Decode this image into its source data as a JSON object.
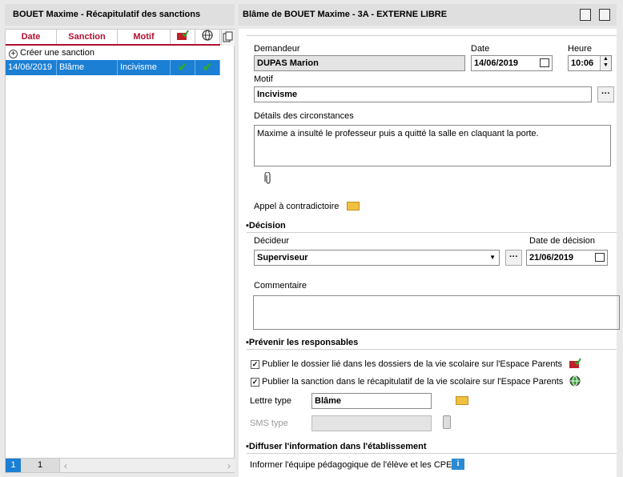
{
  "left": {
    "title": "BOUET Maxime - Récapitulatif des sanctions",
    "columns": [
      "Date",
      "Sanction",
      "Motif"
    ],
    "create_label": "Créer une sanction",
    "row": {
      "date": "14/06/2019",
      "sanction": "Blâme",
      "motif": "Incivisme"
    },
    "pager": {
      "first": "1",
      "current": "1"
    }
  },
  "right": {
    "title": "Blâme de BOUET Maxime  - 3A - EXTERNE LIBRE",
    "demandeur_label": "Demandeur",
    "demandeur_value": "DUPAS Marion",
    "date_label": "Date",
    "date_value": "14/06/2019",
    "heure_label": "Heure",
    "heure_value": "10:06",
    "motif_label": "Motif",
    "motif_value": "Incivisme",
    "details_label": "Détails des circonstances",
    "details_value": "Maxime a insulté le professeur puis a quitté la salle en claquant la porte.",
    "appel_label": "Appel à contradictoire",
    "decision_section": "Décision",
    "decideur_label": "Décideur",
    "decideur_value": "Superviseur",
    "date_decision_label": "Date de décision",
    "date_decision_value": "21/06/2019",
    "commentaire_label": "Commentaire",
    "prevenir_section": "Prévenir les responsables",
    "check1_label": "Publier le dossier lié dans les dossiers de la vie scolaire sur l'Espace Parents",
    "check2_label": "Publier la sanction dans le récapitulatif de la vie scolaire sur l'Espace Parents",
    "lettre_label": "Lettre type",
    "lettre_value": "Blâme",
    "sms_label": "SMS type",
    "diffuser_section": "Diffuser l'information dans l'établissement",
    "informer_label": "Informer l'équipe pédagogique de l'élève et les CPE",
    "dots": "···"
  },
  "colors": {
    "accent": "#b01030",
    "selection": "#1b7fd4",
    "check": "#2ea82e"
  }
}
